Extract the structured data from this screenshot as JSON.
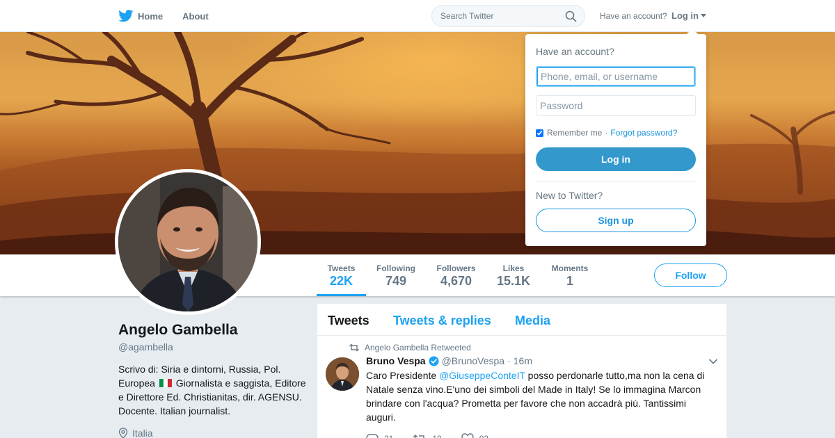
{
  "nav": {
    "home_label": "Home",
    "about_label": "About",
    "search_placeholder": "Search Twitter",
    "have_account_text": "Have an account?",
    "login_label": "Log in",
    "icons": {
      "brand": "twitter-bird-icon",
      "search": "search-icon"
    }
  },
  "profile": {
    "name": "Angelo Gambella",
    "handle": "@agambella",
    "bio_part1": "Scrivo di: Siria e dintorni, Russia, Pol. Europea",
    "bio_part2": "Giornalista e saggista, Editore e Direttore Ed. Christianitas, dir. AGENSU. Docente. Italian journalist.",
    "location": "Italia"
  },
  "stats": [
    {
      "label": "Tweets",
      "value": "22K",
      "active": true
    },
    {
      "label": "Following",
      "value": "749",
      "active": false
    },
    {
      "label": "Followers",
      "value": "4,670",
      "active": false
    },
    {
      "label": "Likes",
      "value": "15.1K",
      "active": false
    },
    {
      "label": "Moments",
      "value": "1",
      "active": false
    }
  ],
  "follow_label": "Follow",
  "timeline": {
    "tabs": [
      "Tweets",
      "Tweets & replies",
      "Media"
    ],
    "active_tab": "Tweets",
    "tweet": {
      "context": "Angelo Gambella Retweeted",
      "author_name": "Bruno Vespa",
      "author_handle": "@BrunoVespa",
      "time": "16m",
      "text_prefix": "Caro Presidente ",
      "mention": "@GiuseppeConteIT",
      "text_rest": " posso perdonarle tutto,ma non la cena di Natale senza vino.E'uno dei simboli del Made in Italy! Se lo immagina Marcon brindare con l'acqua? Prometta per favore che non accadrà più. Tantissimi auguri.",
      "replies": "21",
      "retweets": "18",
      "likes": "93"
    }
  },
  "login_dropdown": {
    "title": "Have an account?",
    "username_placeholder": "Phone, email, or username",
    "password_placeholder": "Password",
    "remember_label": "Remember me",
    "separator": "·",
    "forgot_label": "Forgot password?",
    "login_button": "Log in",
    "new_to_twitter": "New to Twitter?",
    "signup_button": "Sign up",
    "remember_checked": true
  },
  "colors": {
    "accent": "#1da1f2",
    "login_button": "#3399cc",
    "page_bg": "#e6ecf0"
  }
}
